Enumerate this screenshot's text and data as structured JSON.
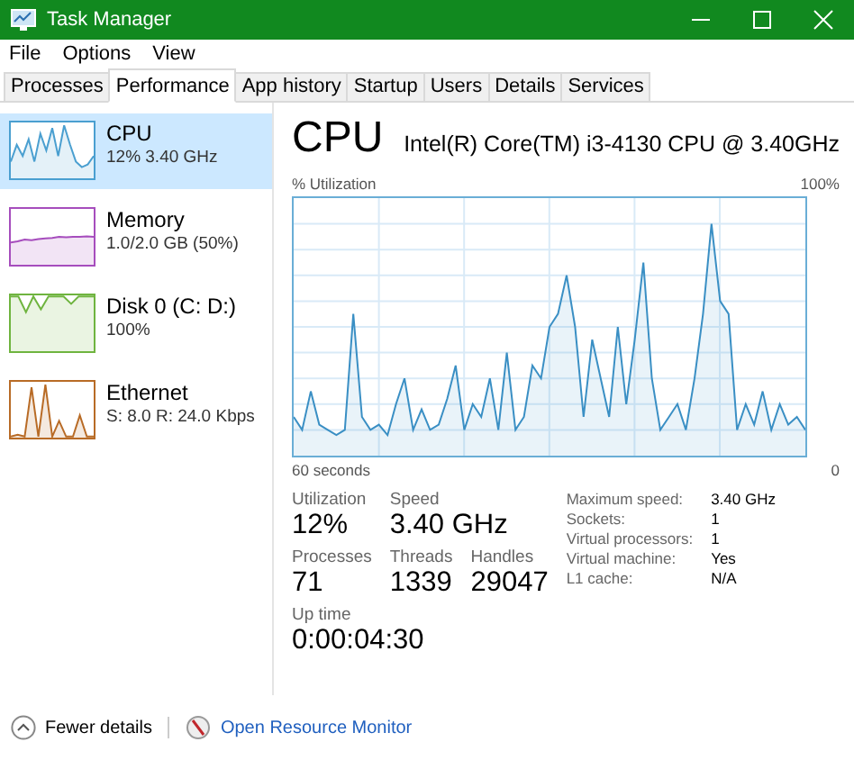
{
  "window": {
    "title": "Task Manager"
  },
  "menu": [
    "File",
    "Options",
    "View"
  ],
  "tabs": [
    {
      "label": "Processes",
      "selected": false
    },
    {
      "label": "Performance",
      "selected": true
    },
    {
      "label": "App history",
      "selected": false
    },
    {
      "label": "Startup",
      "selected": false
    },
    {
      "label": "Users",
      "selected": false
    },
    {
      "label": "Details",
      "selected": false
    },
    {
      "label": "Services",
      "selected": false
    }
  ],
  "sidebar": {
    "items": [
      {
        "name": "CPU",
        "detail": "12% 3.40 GHz",
        "selected": true,
        "color": "#4a9fd0"
      },
      {
        "name": "Memory",
        "detail": "1.0/2.0 GB (50%)",
        "selected": false,
        "color": "#a64dbd"
      },
      {
        "name": "Disk 0 (C: D:)",
        "detail": "100%",
        "selected": false,
        "color": "#6fb43f"
      },
      {
        "name": "Ethernet",
        "detail": "S: 8.0 R: 24.0 Kbps",
        "selected": false,
        "color": "#b86b26"
      }
    ]
  },
  "panel": {
    "title": "CPU",
    "model": "Intel(R) Core(TM) i3-4130 CPU @ 3.40GHz",
    "graph_label": "% Utilization",
    "graph_max": "100%",
    "graph_span": "60 seconds",
    "graph_min": "0",
    "stats": [
      {
        "label": "Utilization",
        "value": "12%"
      },
      {
        "label": "Speed",
        "value": "3.40 GHz"
      },
      {
        "label": "Processes",
        "value": "71"
      },
      {
        "label": "Threads",
        "value": "1339"
      },
      {
        "label": "Handles",
        "value": "29047"
      },
      {
        "label": "Up time",
        "value": "0:00:04:30"
      }
    ],
    "details": [
      {
        "label": "Maximum speed:",
        "value": "3.40 GHz"
      },
      {
        "label": "Sockets:",
        "value": "1"
      },
      {
        "label": "Virtual processors:",
        "value": "1"
      },
      {
        "label": "Virtual machine:",
        "value": "Yes"
      },
      {
        "label": "L1 cache:",
        "value": "N/A"
      }
    ]
  },
  "footer": {
    "fewer_details": "Fewer details",
    "resource_monitor": "Open Resource Monitor"
  }
}
